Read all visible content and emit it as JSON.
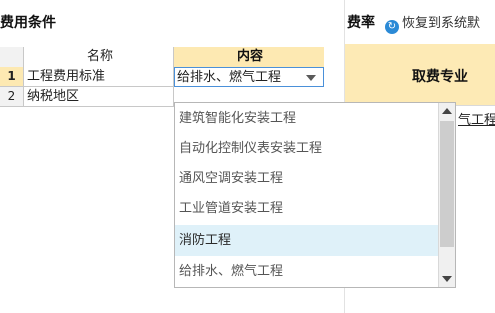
{
  "left": {
    "title": "费用条件",
    "table": {
      "headers": {
        "name": "名称",
        "content": "内容"
      },
      "rows": [
        {
          "index": "1",
          "name": "工程费用标准",
          "content": "给排水、燃气工程"
        },
        {
          "index": "2",
          "name": "纳税地区",
          "content": ""
        }
      ]
    },
    "dropdown": {
      "items": [
        "建筑智能化安装工程",
        "自动化控制仪表安装工程",
        "通风空调安装工程",
        "工业管道安装工程",
        "消防工程",
        "给排水、燃气工程"
      ],
      "selected_index": 4
    }
  },
  "right": {
    "title": "费率",
    "restore_label": "恢复到系统默",
    "column_header": "取费专业",
    "cell_value": "气工程"
  },
  "icons": {
    "restore": "refresh-icon",
    "dropdown": "chevron-down-icon",
    "scroll_up": "arrow-up-icon",
    "scroll_down": "arrow-down-icon"
  },
  "colors": {
    "header_highlight": "#fde9b2",
    "selected_item": "#dff1f9",
    "focus_border": "#4a90d9",
    "restore_icon": "#2b8ad6"
  }
}
